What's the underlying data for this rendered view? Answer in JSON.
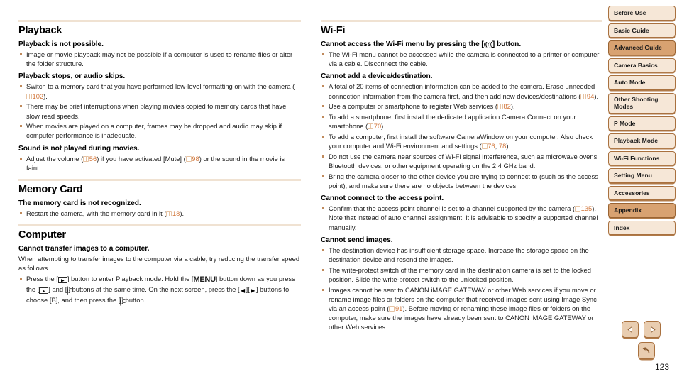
{
  "page": {
    "number": "123"
  },
  "colors": {
    "section_rule": "#f0e2d2",
    "bullet": "#c08a5c",
    "page_ref_link": "#d2763a",
    "tab_border": "#a9713f",
    "tab_background": "#f6e7d7",
    "tab_active_background": "#d8a271"
  },
  "left_column": {
    "sections": [
      {
        "title": "Playback",
        "blocks": [
          {
            "heading": "Playback is not possible.",
            "bullets": [
              "Image or movie playback may not be possible if a computer is used to rename files or alter the folder structure."
            ]
          },
          {
            "heading": "Playback stops, or audio skips.",
            "bullets": [
              "Switch to a memory card that you have performed low-level formatting on with the camera (<ref>102</ref>).",
              "There may be brief interruptions when playing movies copied to memory cards that have slow read speeds.",
              "When movies are played on a computer, frames may be dropped and audio may skip if computer performance is inadequate."
            ]
          },
          {
            "heading": "Sound is not played during movies.",
            "bullets": [
              "Adjust the volume (<ref>56</ref>) if you have activated [Mute] (<ref>98</ref>) or the sound in the movie is faint."
            ]
          }
        ]
      },
      {
        "title": "Memory Card",
        "blocks": [
          {
            "heading": "The memory card is not recognized.",
            "bullets": [
              "Restart the camera, with the memory card in it (<ref>18</ref>)."
            ]
          }
        ]
      },
      {
        "title": "Computer",
        "blocks": [
          {
            "heading": "Cannot transfer images to a computer.",
            "paragraph": "When attempting to transfer images to the computer via a cable, try reducing the transfer speed as follows.",
            "bullets": [
              "Press the [<icon>play</icon>] button to enter Playback mode. Hold the [<icon>menu</icon>] button down as you press the [<icon>up</icon>] and [<icon>func</icon>] buttons at the same time. On the next screen, press the [<icon>left</icon>][<icon>right</icon>] buttons to choose [B], and then press the [<icon>func</icon>] button."
            ]
          }
        ]
      }
    ]
  },
  "right_column": {
    "sections": [
      {
        "title": "Wi-Fi",
        "blocks": [
          {
            "heading": "Cannot access the Wi-Fi menu by pressing the [<icon>wifi</icon>] button.",
            "bullets": [
              "The Wi-Fi menu cannot be accessed while the camera is connected to a printer or computer via a cable. Disconnect the cable."
            ]
          },
          {
            "heading": "Cannot add a device/destination.",
            "bullets": [
              "A total of 20 items of connection information can be added to the camera. Erase unneeded connection information from the camera first, and then add new devices/destinations (<ref>94</ref>).",
              "Use a computer or smartphone to register Web services (<ref>82</ref>).",
              "To add a smartphone, first install the dedicated application Camera Connect on your smartphone (<ref>70</ref>).",
              "To add a computer, first install the software CameraWindow on your computer. Also check your computer and Wi-Fi environment and settings (<ref>76</ref>, <ref2>78</ref2>).",
              "Do not use the camera near sources of Wi-Fi signal interference, such as microwave ovens, Bluetooth devices, or other equipment operating on the 2.4 GHz band.",
              "Bring the camera closer to the other device you are trying to connect to (such as the access point), and make sure there are no objects between the devices."
            ]
          },
          {
            "heading": "Cannot connect to the access point.",
            "bullets": [
              "Confirm that the access point channel is set to a channel supported by the camera (<ref>135</ref>). Note that instead of auto channel assignment, it is advisable to specify a supported channel manually."
            ]
          },
          {
            "heading": "Cannot send images.",
            "bullets": [
              "The destination device has insufficient storage space. Increase the storage space on the destination device and resend the images.",
              "The write-protect switch of the memory card in the destination camera is set to the locked position. Slide the write-protect switch to the unlocked position.",
              "Images cannot be sent to CANON iMAGE GATEWAY or other Web services if you move or rename image files or folders on the computer that received images sent using Image Sync via an access point (<ref>91</ref>). Before moving or renaming these image files or folders on the computer, make sure the images have already been sent to CANON iMAGE GATEWAY or other Web services."
            ]
          }
        ]
      }
    ]
  },
  "sidebar": {
    "tabs": [
      {
        "label": "Before Use",
        "active": false,
        "lines": 1
      },
      {
        "label": "Basic Guide",
        "active": false,
        "lines": 1
      },
      {
        "label": "Advanced Guide",
        "active": true,
        "lines": 1
      },
      {
        "label": "Camera Basics",
        "active": false,
        "lines": 1
      },
      {
        "label": "Auto Mode",
        "active": false,
        "lines": 1
      },
      {
        "label": "Other Shooting Modes",
        "active": false,
        "lines": 2
      },
      {
        "label": "P Mode",
        "active": false,
        "lines": 1
      },
      {
        "label": "Playback Mode",
        "active": false,
        "lines": 1
      },
      {
        "label": "Wi-Fi Functions",
        "active": false,
        "lines": 1
      },
      {
        "label": "Setting Menu",
        "active": false,
        "lines": 1
      },
      {
        "label": "Accessories",
        "active": false,
        "lines": 1
      },
      {
        "label": "Appendix",
        "active": true,
        "lines": 1
      },
      {
        "label": "Index",
        "active": false,
        "lines": 1
      }
    ]
  },
  "nav": {
    "prev_label": "previous-page",
    "next_label": "next-page",
    "back_label": "back"
  }
}
